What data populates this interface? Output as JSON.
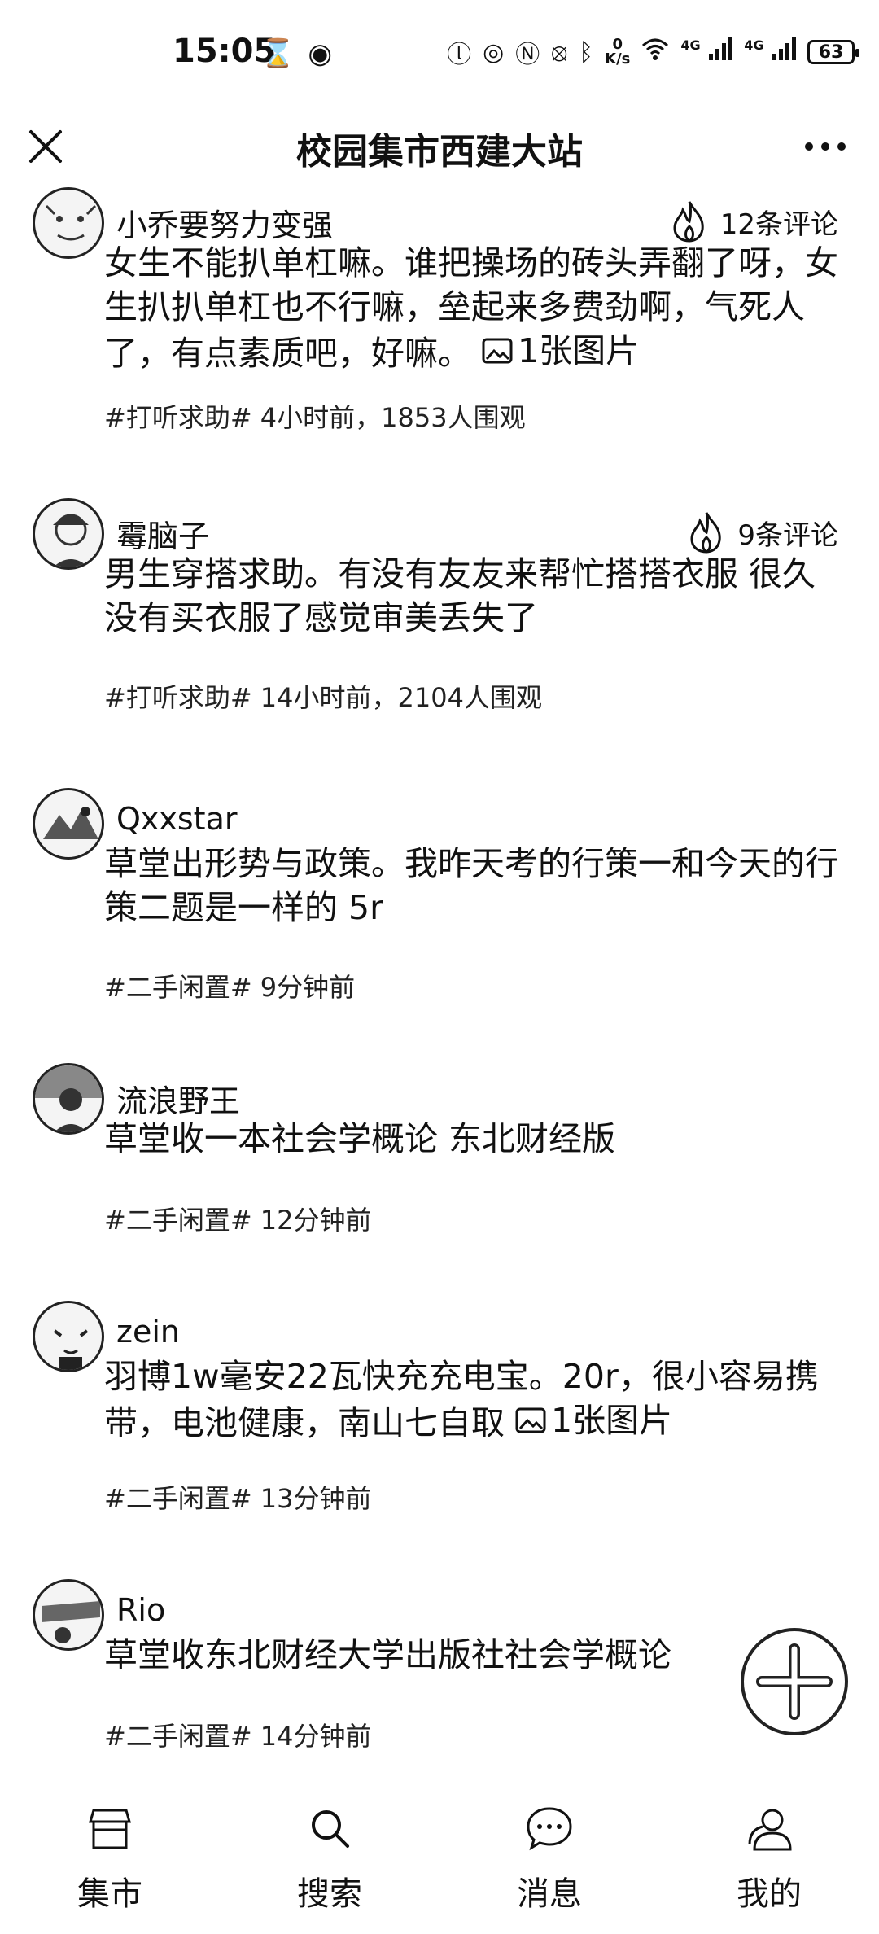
{
  "status_bar": {
    "time": "15:05",
    "speed_value": "0",
    "speed_unit": "K/s",
    "network_label_1": "4G",
    "network_label_2": "4G",
    "battery": "63"
  },
  "header": {
    "title": "校园集市西建大站",
    "close_icon": "close-icon",
    "more_icon": "more-icon"
  },
  "posts": [
    {
      "username": "小乔要努力变强",
      "comments": "12条评论",
      "text": "女生不能扒单杠嘛。谁把操场的砖头弄翻了呀，女生扒扒单杠也不行嘛，垒起来多费劲啊，气死人了，有点素质吧，好嘛。",
      "image_label": "1张图片",
      "meta": "#打听求助# 4小时前，1853人围观"
    },
    {
      "username": "霉脑子",
      "comments": "9条评论",
      "text": "男生穿搭求助。有没有友友来帮忙搭搭衣服 很久没有买衣服了感觉审美丢失了",
      "meta": "#打听求助# 14小时前，2104人围观"
    },
    {
      "username": "Qxxstar",
      "text": "草堂出形势与政策。我昨天考的行策一和今天的行策二题是一样的 5r",
      "meta": "#二手闲置# 9分钟前"
    },
    {
      "username": "流浪野王",
      "text": "草堂收一本社会学概论 东北财经版",
      "meta": "#二手闲置# 12分钟前"
    },
    {
      "username": "zein",
      "text": "羽博1w毫安22瓦快充充电宝。20r，很小容易携带，电池健康，南山七自取",
      "image_label": "1张图片",
      "meta": "#二手闲置# 13分钟前"
    },
    {
      "username": "Rio",
      "text": "草堂收东北财经大学出版社社会学概论",
      "meta": "#二手闲置# 14分钟前"
    }
  ],
  "bottom_nav": {
    "market": "集市",
    "search": "搜索",
    "messages": "消息",
    "mine": "我的"
  }
}
